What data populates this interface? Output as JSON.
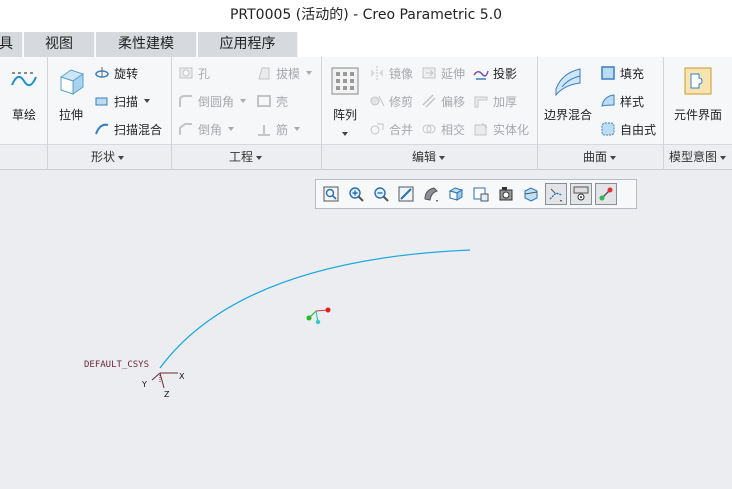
{
  "window": {
    "title": "PRT0005 (活动的) - Creo Parametric 5.0"
  },
  "tabs": [
    {
      "label": "具"
    },
    {
      "label": "视图"
    },
    {
      "label": "柔性建模"
    },
    {
      "label": "应用程序"
    }
  ],
  "ribbon": {
    "sketch": {
      "label": "草绘"
    },
    "shape": {
      "group_label": "形状",
      "extrude": "拉伸",
      "revolve": "旋转",
      "sweep": "扫描",
      "swept_blend": "扫描混合"
    },
    "engineering": {
      "group_label": "工程",
      "hole": "孔",
      "draft": "拔模",
      "round": "倒圆角",
      "shell": "壳",
      "chamfer": "倒角",
      "rib": "筋"
    },
    "editing": {
      "group_label": "编辑",
      "pattern": "阵列",
      "mirror": "镜像",
      "extend": "延伸",
      "project": "投影",
      "trim": "修剪",
      "offset": "偏移",
      "thicken": "加厚",
      "merge": "合并",
      "intersect": "相交",
      "solidify": "实体化"
    },
    "surfaces": {
      "group_label": "曲面",
      "boundary_blend": "边界混合",
      "fill": "填充",
      "style": "样式",
      "freestyle": "自由式"
    },
    "model_intent": {
      "group_label": "模型意图",
      "component_interface": "元件界面"
    }
  },
  "graphics_toolbar": {
    "icons": [
      "refit-icon",
      "zoom-in-icon",
      "zoom-out-icon",
      "repaint-icon",
      "display-style-icon",
      "saved-orientations-icon",
      "view-manager-icon",
      "perspective-icon",
      "section-icon",
      "datum-display-icon",
      "spin-center-icon",
      "annotation-display-icon"
    ]
  },
  "scene": {
    "csys_label": "DEFAULT_CSYS",
    "axis_x": "X",
    "axis_y": "Y",
    "axis_z": "Z",
    "curve_color": "#19a7e0"
  },
  "colors": {
    "accent": "#19a7e0",
    "csys_text": "#6b2a3a"
  }
}
